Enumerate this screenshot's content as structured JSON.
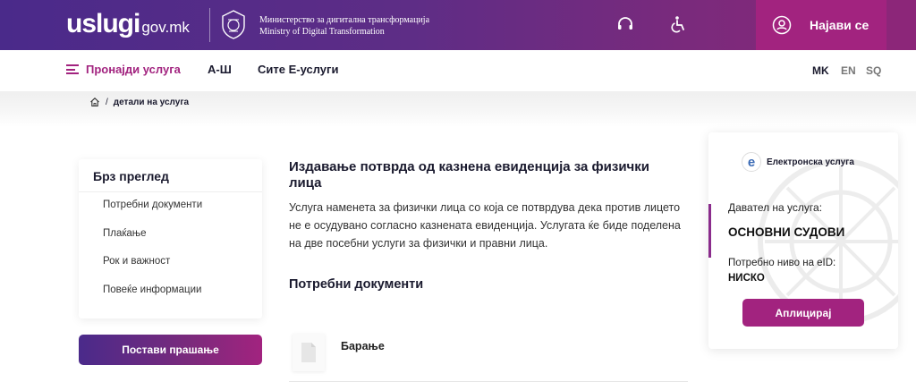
{
  "header": {
    "logo_main": "uslugi",
    "logo_sub": "gov.mk",
    "ministry_mk": "Министерство за дигитална трансформација",
    "ministry_en": "Ministry of Digital Transformation",
    "login_label": "Најави се",
    "support_icon": "headset-icon",
    "accessibility_icon": "accessibility-icon"
  },
  "nav": {
    "find_service": "Пронајди услуга",
    "a_z": "А-Ш",
    "e_services": "Сите Е-услуги",
    "languages": [
      "MK",
      "EN",
      "SQ"
    ]
  },
  "breadcrumb": {
    "current": "детали на услуга"
  },
  "overview": {
    "title": "Брз преглед",
    "links": [
      "Потребни документи",
      "Плаќање",
      "Рок и важност",
      "Повеќе информации"
    ],
    "ask_button": "Постави прашање"
  },
  "main": {
    "title": "Издавање потврда од казнена евиденција за физички лица",
    "description": "Услуга наменета за физички лица со која се потврдува дека против лицето не е осудувано согласно казнената евиденција. Услугата ќе биде поделена на две посебни услуги за физички и правни лица.",
    "docs_heading": "Потребни документи",
    "documents": [
      "Барање"
    ]
  },
  "card": {
    "badge_letter": "e",
    "badge_label": "Електронска услуга",
    "provider_label": "Давател на услуга:",
    "provider_value": "ОСНОВНИ СУДОВИ",
    "eid_label": "Потребно ниво на eID:",
    "eid_value": "НИСКО",
    "apply_button": "Аплицирај"
  },
  "colors": {
    "brand_purple": "#4a2a8a",
    "brand_magenta": "#a2237f"
  }
}
